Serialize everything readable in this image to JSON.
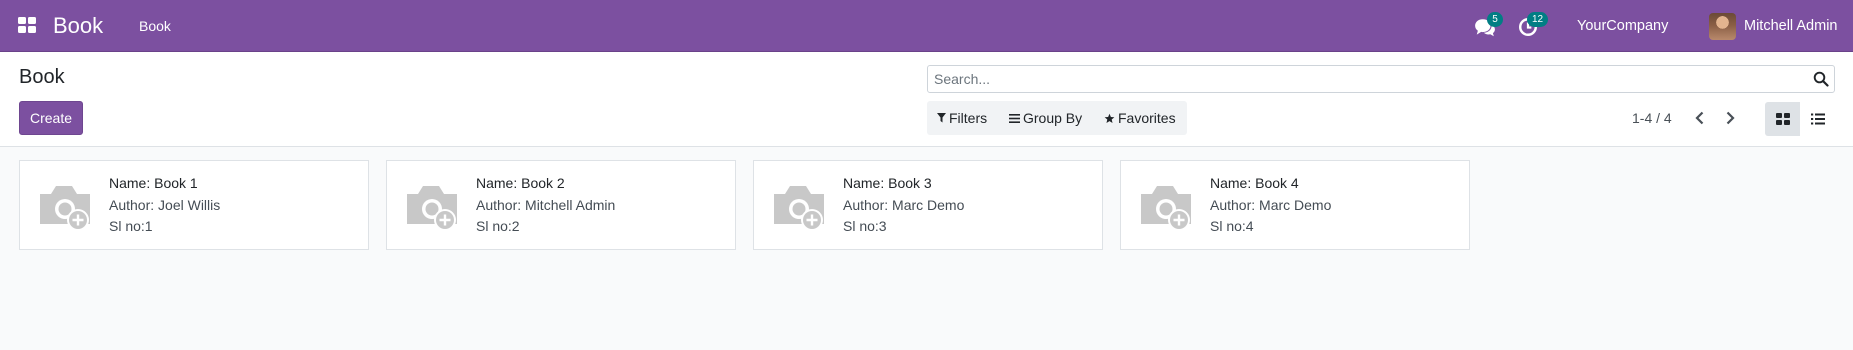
{
  "navbar": {
    "brand": "Book",
    "menu_items": [
      "Book"
    ],
    "messages_count": "5",
    "activities_count": "12",
    "company": "YourCompany",
    "user": "Mitchell Admin"
  },
  "control_panel": {
    "title": "Book",
    "create_label": "Create",
    "search_placeholder": "Search...",
    "filters_label": "Filters",
    "groupby_label": "Group By",
    "favorites_label": "Favorites",
    "pager": "1-4 / 4"
  },
  "cards": [
    {
      "name": "Name: Book 1",
      "author": "Author: Joel Willis",
      "slno": "Sl no:1"
    },
    {
      "name": "Name: Book 2",
      "author": "Author: Mitchell Admin",
      "slno": "Sl no:2"
    },
    {
      "name": "Name: Book 3",
      "author": "Author: Marc Demo",
      "slno": "Sl no:3"
    },
    {
      "name": "Name: Book 4",
      "author": "Author: Marc Demo",
      "slno": "Sl no:4"
    }
  ],
  "colors": {
    "brand": "#7c50a0",
    "badge": "#017e84",
    "background": "#f9fafb"
  },
  "icons": [
    "apps-grid-icon",
    "chat-icon",
    "clock-icon",
    "search-icon",
    "filter-icon",
    "group-by-icon",
    "star-icon",
    "chevron-left-icon",
    "chevron-right-icon",
    "kanban-view-icon",
    "list-view-icon",
    "camera-add-icon"
  ]
}
